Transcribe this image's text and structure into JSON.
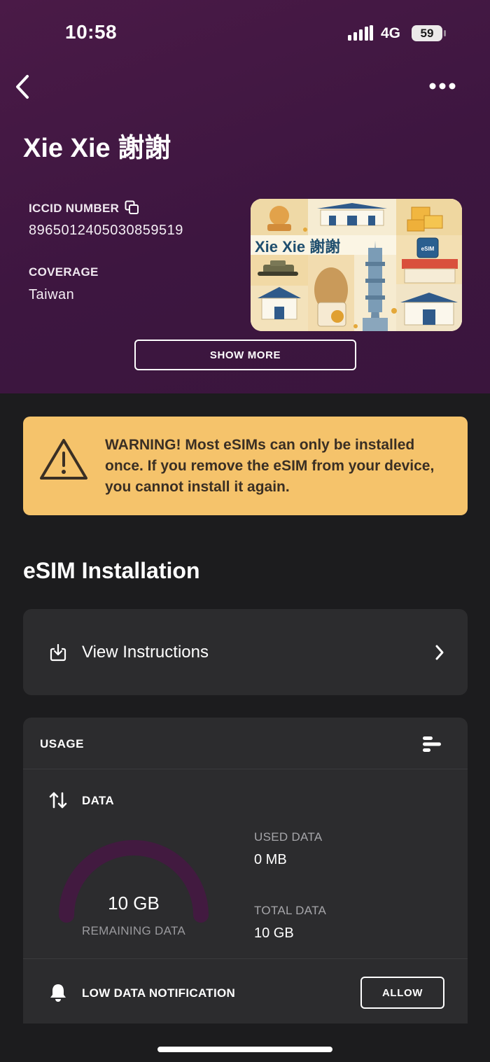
{
  "status_bar": {
    "time": "10:58",
    "network": "4G",
    "battery": "59"
  },
  "header": {
    "title": "Xie Xie 謝謝"
  },
  "details": {
    "iccid_label": "ICCID NUMBER",
    "iccid_value": "8965012405030859519",
    "coverage_label": "COVERAGE",
    "coverage_value": "Taiwan",
    "show_more_label": "SHOW MORE"
  },
  "card_art": {
    "brand_text": "Xie Xie 謝謝",
    "chip_text": "eSIM"
  },
  "warning": {
    "text": "WARNING! Most eSIMs can only be installed once. If you remove the eSIM from your device, you cannot install it again.",
    "color": "#f5c36b"
  },
  "installation": {
    "title": "eSIM Installation",
    "instructions_label": "View Instructions"
  },
  "usage": {
    "header": "USAGE",
    "data_label": "DATA",
    "remaining_value": "10 GB",
    "remaining_label": "REMAINING DATA",
    "remaining_fraction": 1.0,
    "used_label": "USED DATA",
    "used_value": "0 MB",
    "total_label": "TOTAL DATA",
    "total_value": "10 GB",
    "notification_label": "LOW DATA NOTIFICATION",
    "allow_label": "ALLOW"
  },
  "colors": {
    "hero": "#3d1640",
    "gauge": "#421a40",
    "card": "#2c2c2e",
    "background": "#1c1c1e"
  }
}
